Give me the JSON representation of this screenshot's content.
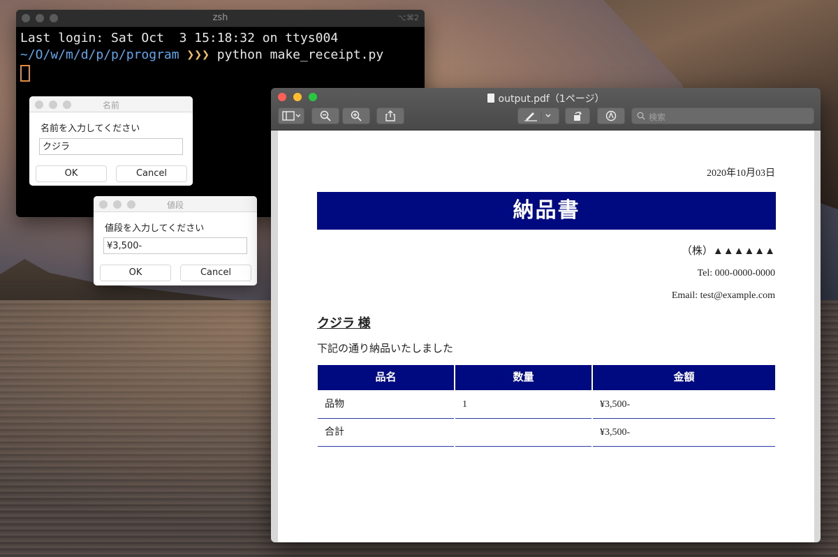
{
  "terminal": {
    "title": "zsh",
    "shortcut": "⌥⌘2",
    "lines": {
      "login": "Last login: Sat Oct  3 15:18:32 on ttys004",
      "prompt_path": "~/O/w/m/d/p/p/program",
      "prompt_arrows": "❯❯❯",
      "command": "python make_receipt.py"
    }
  },
  "dialog_name": {
    "title": "名前",
    "prompt": "名前を入力してください",
    "value": "クジラ",
    "ok_label": "OK",
    "cancel_label": "Cancel"
  },
  "dialog_price": {
    "title": "値段",
    "prompt": "値段を入力してください",
    "value": "¥3,500-",
    "ok_label": "OK",
    "cancel_label": "Cancel"
  },
  "preview": {
    "title": "output.pdf（1ページ）",
    "search_placeholder": "検索",
    "colors": {
      "close": "#fe5f57",
      "minimize": "#febc2e",
      "zoom": "#28c840"
    }
  },
  "document": {
    "date": "2020年10月03日",
    "heading": "納品書",
    "company": "（株）▲▲▲▲▲▲",
    "tel": "Tel: 000-0000-0000",
    "email": "Email: test@example.com",
    "customer": "クジラ 様",
    "message": "下記の通り納品いたしました",
    "accent_color": "#000a80",
    "table": {
      "headers": [
        "品名",
        "数量",
        "金額"
      ],
      "rows": [
        [
          "品物",
          "1",
          "¥3,500-"
        ],
        [
          "合計",
          "",
          "¥3,500-"
        ]
      ]
    }
  }
}
